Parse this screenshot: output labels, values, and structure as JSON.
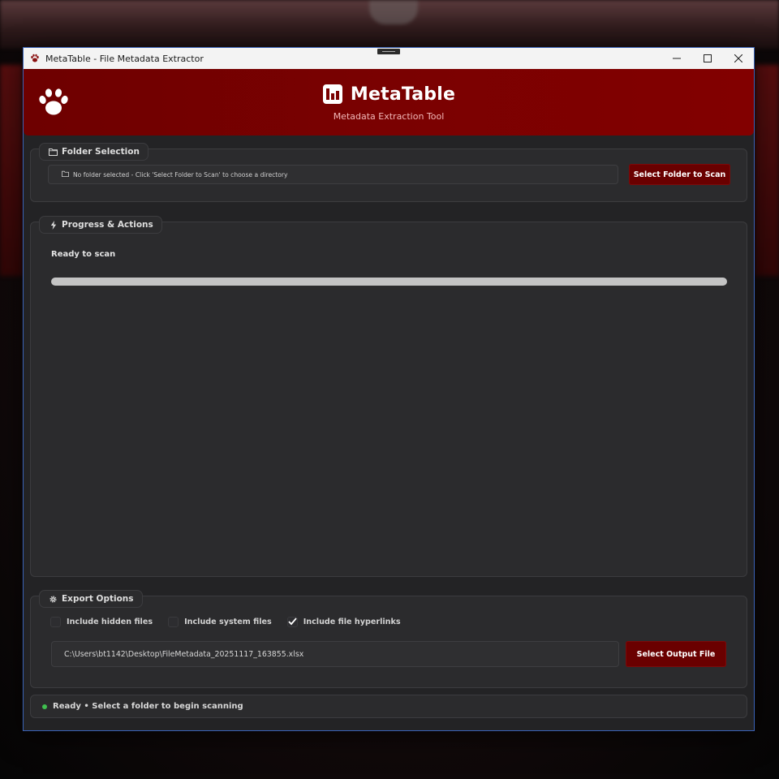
{
  "window": {
    "title": "MetaTable - File Metadata Extractor",
    "controls": {
      "minimize": "—",
      "maximize": "☐",
      "close": "✕"
    }
  },
  "header": {
    "title": "MetaTable",
    "subtitle": "Metadata Extraction Tool",
    "logo_icon": "bar-chart-icon",
    "brand_icon": "paw-icon"
  },
  "folder_selection": {
    "label": "Folder Selection",
    "icon": "folder-icon",
    "path_text": "No folder selected - Click 'Select Folder to Scan' to choose a directory",
    "button_label": "Select Folder to Scan"
  },
  "progress": {
    "label": "Progress & Actions",
    "icon": "lightning-icon",
    "status": "Ready to scan",
    "value": 0
  },
  "export_options": {
    "label": "Export Options",
    "icon": "gear-icon",
    "checkboxes": [
      {
        "label": "Include hidden files",
        "checked": false
      },
      {
        "label": "Include system files",
        "checked": false
      },
      {
        "label": "Include file hyperlinks",
        "checked": true
      }
    ],
    "output_path": "C:\\Users\\bt1142\\Desktop\\FileMetadata_20251117_163855.xlsx",
    "button_label": "Select Output File"
  },
  "statusbar": {
    "text": "Ready • Select a folder to begin scanning",
    "dot_color": "#3fbf4f"
  },
  "colors": {
    "accent": "#7a0000",
    "panel": "#2b2b2d",
    "background": "#232325"
  }
}
